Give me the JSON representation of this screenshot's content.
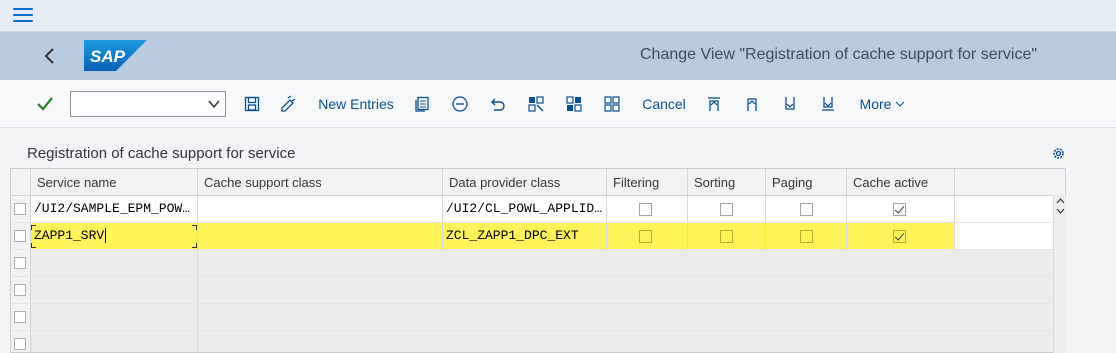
{
  "menu": {
    "icon": "hamburger-icon"
  },
  "shell": {
    "logo_text": "SAP",
    "title": "Change View \"Registration of cache support for service\"",
    "brand_color": "#0a6ed1"
  },
  "toolbar": {
    "command_value": "",
    "new_entries_label": "New Entries",
    "cancel_label": "Cancel",
    "more_label": "More"
  },
  "table": {
    "title": "Registration of cache support for service",
    "columns": [
      "Service name",
      "Cache support class",
      "Data provider class",
      "Filtering",
      "Sorting",
      "Paging",
      "Cache active"
    ],
    "rows": [
      {
        "service": "/UI2/SAMPLE_EPM_POW…",
        "cache_class": "",
        "dpc": "/UI2/CL_POWL_APPLID…",
        "filtering": false,
        "sorting": false,
        "paging": false,
        "cache_active": true,
        "highlight": false
      },
      {
        "service": "ZAPP1_SRV",
        "cache_class": "",
        "dpc": "ZCL_ZAPP1_DPC_EXT",
        "filtering": false,
        "sorting": false,
        "paging": false,
        "cache_active": true,
        "highlight": true
      }
    ],
    "empty_rows": 4
  }
}
